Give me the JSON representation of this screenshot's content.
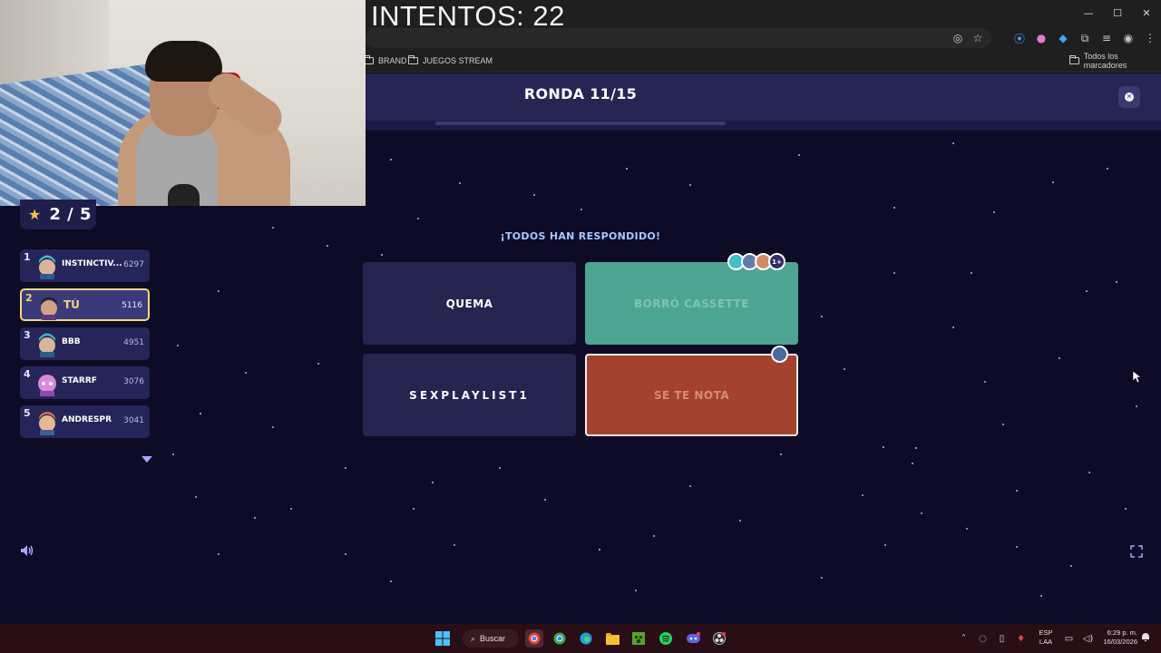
{
  "overlay": {
    "intentos": "INTENTOS: 22"
  },
  "window_controls": {
    "minimize": "—",
    "maximize": "☐",
    "close": "✕"
  },
  "bookmarks": {
    "items": [
      {
        "label": "BRAND",
        "icon": "folder-icon"
      },
      {
        "label": "JUEGOS STREAM",
        "icon": "folder-icon"
      }
    ],
    "all_bookmarks": "Todos los marcadores"
  },
  "game": {
    "round": "RONDA 11/15",
    "score": "2 / 5",
    "status": "¡TODOS HAN RESPONDIDO!",
    "answers": [
      {
        "label": "QUEMA",
        "state": "default"
      },
      {
        "label": "BORRÓ CASSETTE",
        "state": "correct",
        "voters_more": "1+"
      },
      {
        "label": "SEXPLAYLIST1",
        "state": "default"
      },
      {
        "label": "SE TE NOTA",
        "state": "wrong"
      }
    ],
    "leaderboard": [
      {
        "rank": "1",
        "name": "INSTINCTIV...",
        "score": "6297",
        "avatar": "teal"
      },
      {
        "rank": "2",
        "name": "TÚ",
        "score": "5116",
        "avatar": "dark"
      },
      {
        "rank": "3",
        "name": "BBB",
        "score": "4951",
        "avatar": "teal"
      },
      {
        "rank": "4",
        "name": "STARRF",
        "score": "3076",
        "avatar": "pink"
      },
      {
        "rank": "5",
        "name": "ANDRESPR",
        "score": "3041",
        "avatar": "orange"
      }
    ]
  },
  "taskbar": {
    "search_label": "Buscar",
    "lang_top": "ESP",
    "lang_bottom": "LAA",
    "time": "6:29 p. m.",
    "date": "16/03/2026"
  },
  "colors": {
    "background": "#0d0b26",
    "header": "#262553",
    "answer_default": "#25244f",
    "answer_correct": "#4ea591",
    "answer_wrong": "#a3432f",
    "highlight": "#f3d77a"
  }
}
